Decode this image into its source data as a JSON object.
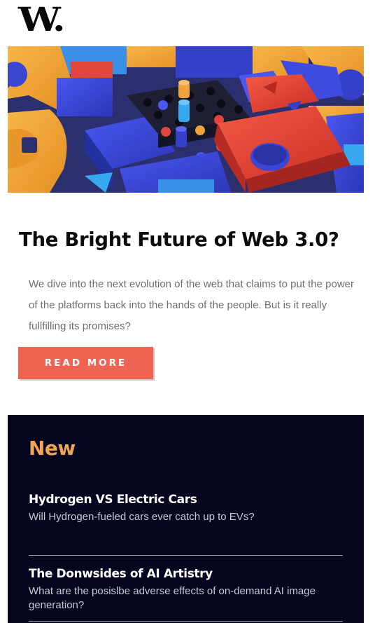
{
  "brand": {
    "logo_text": "W."
  },
  "hero": {
    "image_name": "abstract-3d-blocks-illustration",
    "colors": {
      "orange": "#f2a43a",
      "blue": "#3d4be0",
      "red": "#ef4a3a",
      "navy": "#262844",
      "cyan": "#36a8f0"
    }
  },
  "article": {
    "headline": "The Bright Future of Web 3.0?",
    "summary": "We dive into the next evolution of the web that claims to put the power of the platforms back into the hands of the people. But is it really fullfilling its promises?",
    "cta_label": "READ MORE",
    "cta_color": "#f06252"
  },
  "new_section": {
    "title": "New",
    "accent": "#f2a553",
    "background": "#05051f",
    "items": [
      {
        "title": "Hydrogen VS Electric Cars",
        "description": "Will Hydrogen-fueled cars ever catch up to EVs?"
      },
      {
        "title": "The Donwsides of AI Artistry",
        "description": "What are the posislbe adverse effects of on-demand AI image generation?"
      }
    ]
  }
}
